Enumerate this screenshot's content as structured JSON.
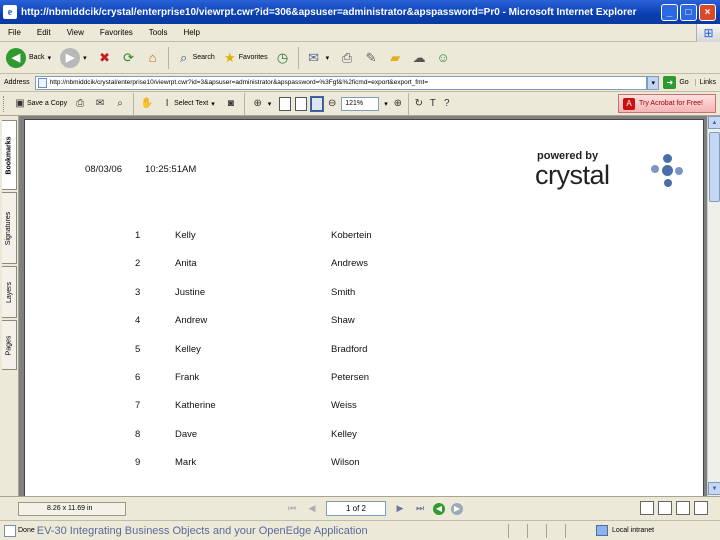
{
  "window": {
    "title": "http://nbmiddcik/crystal/enterprise10/viewrpt.cwr?id=306&apsuser=administrator&apspassword=Pr0 - Microsoft Internet Explorer",
    "app_icon_glyph": "e",
    "controls": {
      "minimize": "_",
      "maximize": "□",
      "close": "×"
    }
  },
  "menu": {
    "items": [
      "File",
      "Edit",
      "View",
      "Favorites",
      "Tools",
      "Help"
    ]
  },
  "toolbar": {
    "back_label": "Back",
    "search_label": "Search",
    "favorites_label": "Favorites"
  },
  "address": {
    "label": "Address",
    "url": "http://nbmiddcik/crystal/enterprise10/viewrpt.cwr?id=3&apsuser=administrator&apspassword=%3Fgf&%2ficmd=export&export_fmt=",
    "go_label": "Go",
    "links_label": "Links"
  },
  "pdf_toolbar": {
    "save_copy_label": "Save a Copy",
    "select_text_label": "Select Text",
    "zoom_value": "121%",
    "acrobat_label": "Try Acrobat for Free!"
  },
  "side_tabs": [
    "Bookmarks",
    "Signatures",
    "Layers",
    "Pages"
  ],
  "report": {
    "date": "08/03/06",
    "time": "10:25:51AM",
    "logo": {
      "powered": "powered by",
      "word": "crystal"
    },
    "rows": [
      {
        "num": "1",
        "first": "Kelly",
        "last": "Kobertein"
      },
      {
        "num": "2",
        "first": "Anita",
        "last": "Andrews"
      },
      {
        "num": "3",
        "first": "Justine",
        "last": "Smith"
      },
      {
        "num": "4",
        "first": "Andrew",
        "last": "Shaw"
      },
      {
        "num": "5",
        "first": "Kelley",
        "last": "Bradford"
      },
      {
        "num": "6",
        "first": "Frank",
        "last": "Petersen"
      },
      {
        "num": "7",
        "first": "Katherine",
        "last": "Weiss"
      },
      {
        "num": "8",
        "first": "Dave",
        "last": "Kelley"
      },
      {
        "num": "9",
        "first": "Mark",
        "last": "Wilson"
      }
    ]
  },
  "navbar": {
    "page_dimensions": "8.26 x 11.69 in",
    "page_field": "1 of 2"
  },
  "status": {
    "done_label": "Done",
    "caption": "EV-30 Integrating Business Objects and your OpenEdge Application",
    "zone_label": "Local intranet"
  }
}
